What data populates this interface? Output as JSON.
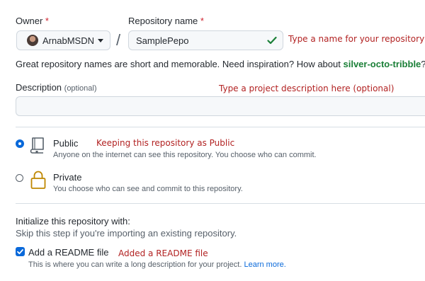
{
  "owner": {
    "label": "Owner",
    "required_marker": "*",
    "value": "ArnabMSDN"
  },
  "separator": "/",
  "repo_name": {
    "label": "Repository name",
    "required_marker": "*",
    "value": "SamplePepo"
  },
  "annotations": {
    "repo_name": "Type a name for your repository",
    "description": "Type a project description here (optional)",
    "visibility": "Keeping  this repository as Public",
    "readme": "Added a README file"
  },
  "help": {
    "text": "Great repository names are short and memorable. Need inspiration? How about",
    "suggestion": "silver-octo-tribble",
    "end": "?"
  },
  "description": {
    "label": "Description",
    "optional": "(optional)",
    "value": ""
  },
  "visibility": {
    "public": {
      "title": "Public",
      "desc": "Anyone on the internet can see this repository. You choose who can commit.",
      "checked": true
    },
    "private": {
      "title": "Private",
      "desc": "You choose who can see and commit to this repository.",
      "checked": false
    }
  },
  "init": {
    "heading": "Initialize this repository with:",
    "subtext": "Skip this step if you're importing an existing repository.",
    "readme_label": "Add a README file",
    "readme_checked": true,
    "readme_desc": "This is where you can write a long description for your project.",
    "learn_more": "Learn more."
  },
  "colors": {
    "accent": "#0969da",
    "success": "#1a7f37",
    "annotation": "#b22222",
    "required": "#cf222e"
  }
}
